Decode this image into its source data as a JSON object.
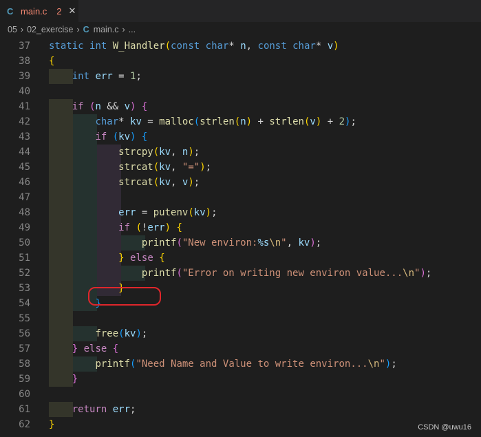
{
  "tab": {
    "icon": "C",
    "filename": "main.c",
    "badge": "2",
    "close": "✕"
  },
  "breadcrumb": {
    "items": [
      "05",
      "02_exercise",
      "main.c",
      "..."
    ],
    "file_icon": "C"
  },
  "lines": [
    {
      "n": "37",
      "tokens": [
        [
          "kw",
          "static"
        ],
        [
          "op",
          " "
        ],
        [
          "ty",
          "int"
        ],
        [
          "op",
          " "
        ],
        [
          "fn",
          "W_Handler"
        ],
        [
          "b1",
          "("
        ],
        [
          "ty",
          "const"
        ],
        [
          "op",
          " "
        ],
        [
          "ty",
          "char"
        ],
        [
          "op",
          "* "
        ],
        [
          "pm",
          "n"
        ],
        [
          "op",
          ", "
        ],
        [
          "ty",
          "const"
        ],
        [
          "op",
          " "
        ],
        [
          "ty",
          "char"
        ],
        [
          "op",
          "* "
        ],
        [
          "pm",
          "v"
        ],
        [
          "b1",
          ")"
        ]
      ]
    },
    {
      "n": "38",
      "tokens": [
        [
          "b1",
          "{"
        ]
      ]
    },
    {
      "n": "39",
      "tokens": [
        [
          "op",
          "    "
        ],
        [
          "ty",
          "int"
        ],
        [
          "op",
          " "
        ],
        [
          "vr",
          "err"
        ],
        [
          "op",
          " = "
        ],
        [
          "nm",
          "1"
        ],
        [
          "op",
          ";"
        ]
      ]
    },
    {
      "n": "40",
      "tokens": []
    },
    {
      "n": "41",
      "tokens": [
        [
          "op",
          "    "
        ],
        [
          "ctl",
          "if"
        ],
        [
          "op",
          " "
        ],
        [
          "b2",
          "("
        ],
        [
          "pm",
          "n"
        ],
        [
          "op",
          " && "
        ],
        [
          "pm",
          "v"
        ],
        [
          "b2",
          ")"
        ],
        [
          "op",
          " "
        ],
        [
          "b2",
          "{"
        ]
      ]
    },
    {
      "n": "42",
      "tokens": [
        [
          "op",
          "        "
        ],
        [
          "ty",
          "char"
        ],
        [
          "op",
          "* "
        ],
        [
          "vr",
          "kv"
        ],
        [
          "op",
          " = "
        ],
        [
          "fn",
          "malloc"
        ],
        [
          "b3",
          "("
        ],
        [
          "fn",
          "strlen"
        ],
        [
          "b1",
          "("
        ],
        [
          "pm",
          "n"
        ],
        [
          "b1",
          ")"
        ],
        [
          "op",
          " + "
        ],
        [
          "fn",
          "strlen"
        ],
        [
          "b1",
          "("
        ],
        [
          "pm",
          "v"
        ],
        [
          "b1",
          ")"
        ],
        [
          "op",
          " + "
        ],
        [
          "nm",
          "2"
        ],
        [
          "b3",
          ")"
        ],
        [
          "op",
          ";"
        ]
      ]
    },
    {
      "n": "43",
      "tokens": [
        [
          "op",
          "        "
        ],
        [
          "ctl",
          "if"
        ],
        [
          "op",
          " "
        ],
        [
          "b3",
          "("
        ],
        [
          "vr",
          "kv"
        ],
        [
          "b3",
          ")"
        ],
        [
          "op",
          " "
        ],
        [
          "b3",
          "{"
        ]
      ]
    },
    {
      "n": "44",
      "tokens": [
        [
          "op",
          "            "
        ],
        [
          "fn",
          "strcpy"
        ],
        [
          "b1",
          "("
        ],
        [
          "vr",
          "kv"
        ],
        [
          "op",
          ", "
        ],
        [
          "pm",
          "n"
        ],
        [
          "b1",
          ")"
        ],
        [
          "op",
          ";"
        ]
      ]
    },
    {
      "n": "45",
      "tokens": [
        [
          "op",
          "            "
        ],
        [
          "fn",
          "strcat"
        ],
        [
          "b1",
          "("
        ],
        [
          "vr",
          "kv"
        ],
        [
          "op",
          ", "
        ],
        [
          "st",
          "\"=\""
        ],
        [
          "b1",
          ")"
        ],
        [
          "op",
          ";"
        ]
      ]
    },
    {
      "n": "46",
      "tokens": [
        [
          "op",
          "            "
        ],
        [
          "fn",
          "strcat"
        ],
        [
          "b1",
          "("
        ],
        [
          "vr",
          "kv"
        ],
        [
          "op",
          ", "
        ],
        [
          "pm",
          "v"
        ],
        [
          "b1",
          ")"
        ],
        [
          "op",
          ";"
        ]
      ]
    },
    {
      "n": "47",
      "tokens": []
    },
    {
      "n": "48",
      "tokens": [
        [
          "op",
          "            "
        ],
        [
          "vr",
          "err"
        ],
        [
          "op",
          " = "
        ],
        [
          "fn",
          "putenv"
        ],
        [
          "b1",
          "("
        ],
        [
          "vr",
          "kv"
        ],
        [
          "b1",
          ")"
        ],
        [
          "op",
          ";"
        ]
      ]
    },
    {
      "n": "49",
      "tokens": [
        [
          "op",
          "            "
        ],
        [
          "ctl",
          "if"
        ],
        [
          "op",
          " "
        ],
        [
          "b1",
          "("
        ],
        [
          "op",
          "!"
        ],
        [
          "vr",
          "err"
        ],
        [
          "b1",
          ")"
        ],
        [
          "op",
          " "
        ],
        [
          "b1",
          "{"
        ]
      ]
    },
    {
      "n": "50",
      "tokens": [
        [
          "op",
          "                "
        ],
        [
          "fn",
          "printf"
        ],
        [
          "b2",
          "("
        ],
        [
          "st",
          "\"New environ:"
        ],
        [
          "vr",
          "%s"
        ],
        [
          "es",
          "\\n"
        ],
        [
          "st",
          "\""
        ],
        [
          "op",
          ", "
        ],
        [
          "vr",
          "kv"
        ],
        [
          "b2",
          ")"
        ],
        [
          "op",
          ";"
        ]
      ]
    },
    {
      "n": "51",
      "tokens": [
        [
          "op",
          "            "
        ],
        [
          "b1",
          "}"
        ],
        [
          "op",
          " "
        ],
        [
          "ctl",
          "else"
        ],
        [
          "op",
          " "
        ],
        [
          "b1",
          "{"
        ]
      ]
    },
    {
      "n": "52",
      "tokens": [
        [
          "op",
          "                "
        ],
        [
          "fn",
          "printf"
        ],
        [
          "b2",
          "("
        ],
        [
          "st",
          "\"Error on writing new environ value..."
        ],
        [
          "es",
          "\\n"
        ],
        [
          "st",
          "\""
        ],
        [
          "b2",
          ")"
        ],
        [
          "op",
          ";"
        ]
      ]
    },
    {
      "n": "53",
      "tokens": [
        [
          "op",
          "            "
        ],
        [
          "b1",
          "}"
        ]
      ]
    },
    {
      "n": "54",
      "tokens": [
        [
          "op",
          "        "
        ],
        [
          "b3",
          "}"
        ]
      ]
    },
    {
      "n": "55",
      "tokens": []
    },
    {
      "n": "56",
      "tokens": [
        [
          "op",
          "        "
        ],
        [
          "fn",
          "free"
        ],
        [
          "b3",
          "("
        ],
        [
          "vr",
          "kv"
        ],
        [
          "b3",
          ")"
        ],
        [
          "op",
          ";"
        ]
      ]
    },
    {
      "n": "57",
      "tokens": [
        [
          "op",
          "    "
        ],
        [
          "b2",
          "}"
        ],
        [
          "op",
          " "
        ],
        [
          "ctl",
          "else"
        ],
        [
          "op",
          " "
        ],
        [
          "b2",
          "{"
        ]
      ]
    },
    {
      "n": "58",
      "tokens": [
        [
          "op",
          "        "
        ],
        [
          "fn",
          "printf"
        ],
        [
          "b3",
          "("
        ],
        [
          "st",
          "\"Need Name and Value to write environ..."
        ],
        [
          "es",
          "\\n"
        ],
        [
          "st",
          "\""
        ],
        [
          "b3",
          ")"
        ],
        [
          "op",
          ";"
        ]
      ]
    },
    {
      "n": "59",
      "tokens": [
        [
          "op",
          "    "
        ],
        [
          "b2",
          "}"
        ]
      ]
    },
    {
      "n": "60",
      "tokens": []
    },
    {
      "n": "61",
      "tokens": [
        [
          "op",
          "    "
        ],
        [
          "ctl",
          "return"
        ],
        [
          "op",
          " "
        ],
        [
          "vr",
          "err"
        ],
        [
          "op",
          ";"
        ]
      ]
    },
    {
      "n": "62",
      "tokens": [
        [
          "b1",
          "}"
        ]
      ]
    }
  ],
  "watermark": "CSDN @uwu16"
}
